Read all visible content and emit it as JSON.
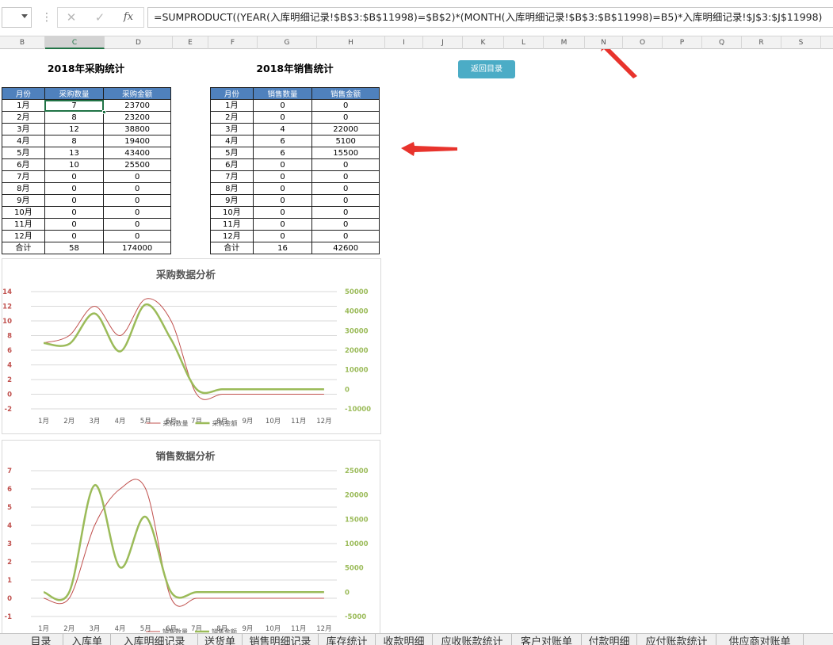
{
  "formula": {
    "fx_label": "fx",
    "cancel_icon": "close-icon",
    "enter_icon": "check-icon",
    "text": "=SUMPRODUCT((YEAR(入库明细记录!$B$3:$B$11998)=$B$2)*(MONTH(入库明细记录!$B$3:$B$11998)=B5)*入库明细记录!$J$3:$J$11998)"
  },
  "columns": [
    "B",
    "C",
    "D",
    "E",
    "F",
    "G",
    "H",
    "I",
    "J",
    "K",
    "L",
    "M",
    "N",
    "O",
    "P",
    "Q",
    "R",
    "S"
  ],
  "selected_column": "C",
  "purchase": {
    "title": "2018年采购统计",
    "headers": [
      "月份",
      "采购数量",
      "采购金额"
    ],
    "rows": [
      [
        "1月",
        "7",
        "23700"
      ],
      [
        "2月",
        "8",
        "23200"
      ],
      [
        "3月",
        "12",
        "38800"
      ],
      [
        "4月",
        "8",
        "19400"
      ],
      [
        "5月",
        "13",
        "43400"
      ],
      [
        "6月",
        "10",
        "25500"
      ],
      [
        "7月",
        "0",
        "0"
      ],
      [
        "8月",
        "0",
        "0"
      ],
      [
        "9月",
        "0",
        "0"
      ],
      [
        "10月",
        "0",
        "0"
      ],
      [
        "11月",
        "0",
        "0"
      ],
      [
        "12月",
        "0",
        "0"
      ]
    ],
    "total": [
      "合计",
      "58",
      "174000"
    ]
  },
  "sales": {
    "title": "2018年销售统计",
    "headers": [
      "月份",
      "销售数量",
      "销售金额"
    ],
    "rows": [
      [
        "1月",
        "0",
        "0"
      ],
      [
        "2月",
        "0",
        "0"
      ],
      [
        "3月",
        "4",
        "22000"
      ],
      [
        "4月",
        "6",
        "5100"
      ],
      [
        "5月",
        "6",
        "15500"
      ],
      [
        "6月",
        "0",
        "0"
      ],
      [
        "7月",
        "0",
        "0"
      ],
      [
        "8月",
        "0",
        "0"
      ],
      [
        "9月",
        "0",
        "0"
      ],
      [
        "10月",
        "0",
        "0"
      ],
      [
        "11月",
        "0",
        "0"
      ],
      [
        "12月",
        "0",
        "0"
      ]
    ],
    "total": [
      "合计",
      "16",
      "42600"
    ]
  },
  "back_button": "返回目录",
  "colors": {
    "header_blue": "#4f81bd",
    "qty_line": "#c0504d",
    "amount_line": "#9bbb59",
    "button": "#4bacc6",
    "arrow": "#e8332c",
    "select_green": "#217346"
  },
  "chart_data": [
    {
      "type": "line",
      "title": "采购数据分析",
      "categories": [
        "1月",
        "2月",
        "3月",
        "4月",
        "5月",
        "6月",
        "7月",
        "8月",
        "9月",
        "10月",
        "11月",
        "12月"
      ],
      "series": [
        {
          "name": "采购数量",
          "axis": "left",
          "values": [
            7,
            8,
            12,
            8,
            13,
            10,
            0,
            0,
            0,
            0,
            0,
            0
          ]
        },
        {
          "name": "采购金额",
          "axis": "right",
          "values": [
            23700,
            23200,
            38800,
            19400,
            43400,
            25500,
            0,
            0,
            0,
            0,
            0,
            0
          ]
        }
      ],
      "y_left": {
        "min": -2,
        "max": 14,
        "ticks": [
          "14",
          "12",
          "10",
          "8",
          "6",
          "4",
          "2",
          "0",
          "-2"
        ]
      },
      "y_right": {
        "min": -10000,
        "max": 50000,
        "ticks": [
          "50000",
          "40000",
          "30000",
          "20000",
          "10000",
          "0",
          "-10000"
        ]
      },
      "legend": "bottom",
      "grid": true
    },
    {
      "type": "line",
      "title": "销售数据分析",
      "categories": [
        "1月",
        "2月",
        "3月",
        "4月",
        "5月",
        "6月",
        "7月",
        "8月",
        "9月",
        "10月",
        "11月",
        "12月"
      ],
      "series": [
        {
          "name": "销售数量",
          "axis": "left",
          "values": [
            0,
            0,
            4,
            6,
            6,
            0,
            0,
            0,
            0,
            0,
            0,
            0
          ]
        },
        {
          "name": "销售金额",
          "axis": "right",
          "values": [
            0,
            0,
            22000,
            5100,
            15500,
            0,
            0,
            0,
            0,
            0,
            0,
            0
          ]
        }
      ],
      "y_left": {
        "min": -1,
        "max": 7,
        "ticks": [
          "7",
          "6",
          "5",
          "4",
          "3",
          "2",
          "1",
          "0",
          "-1"
        ]
      },
      "y_right": {
        "min": -5000,
        "max": 25000,
        "ticks": [
          "25000",
          "20000",
          "15000",
          "10000",
          "5000",
          "0",
          "-5000"
        ]
      },
      "legend": "bottom",
      "grid": true
    }
  ],
  "sheet_tabs": [
    "目录",
    "入库单",
    "入库明细记录",
    "送货单",
    "销售明细记录",
    "库存统计",
    "收款明细",
    "应收账款统计",
    "客户对账单",
    "付款明细",
    "应付账款统计",
    "供应商对账单"
  ]
}
